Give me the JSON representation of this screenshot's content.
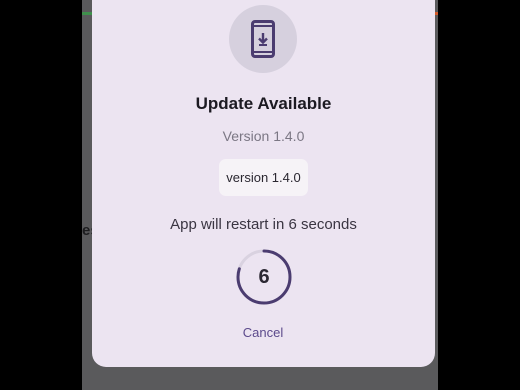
{
  "background": {
    "partial_text": "es"
  },
  "dialog": {
    "icon": "phone-download-icon",
    "title": "Update Available",
    "subtitle": "Version 1.4.0",
    "version_chip": "version 1.4.0",
    "restart_message": "App will restart in 6 seconds",
    "countdown_value": "6",
    "countdown_progress": 0.8,
    "cancel_label": "Cancel"
  },
  "colors": {
    "dialog_bg": "#ece4f1",
    "accent": "#4b3c70",
    "cancel": "#5c4a8c"
  }
}
